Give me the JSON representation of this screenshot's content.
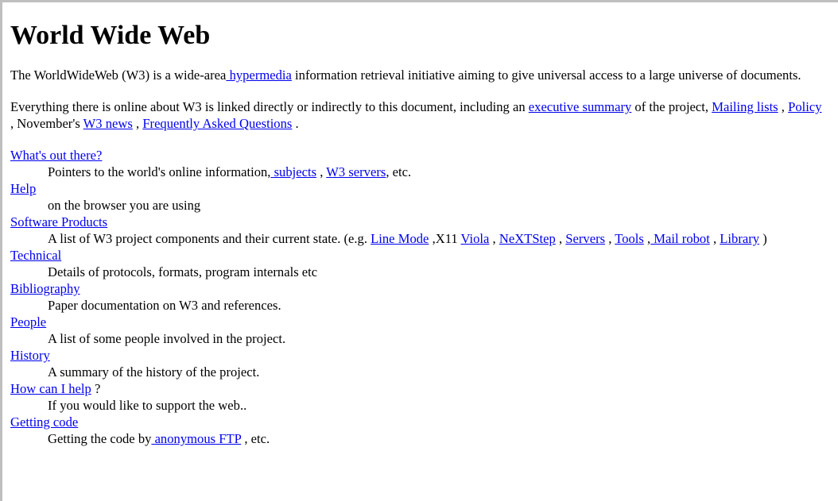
{
  "page": {
    "title": "World Wide Web",
    "intro": {
      "before": "The WorldWideWeb (W3) is a wide-area",
      "link": " hypermedia",
      "after": " information retrieval initiative aiming to give universal access to a large universe of documents."
    },
    "summary": {
      "t1": "Everything there is online about W3 is linked directly or indirectly to this document, including an ",
      "link_exec": "executive summary",
      "t2": " of the project, ",
      "link_mailing": "Mailing lists",
      "t3": " , ",
      "link_policy": "Policy",
      "t4": " , November's ",
      "link_news": "W3 news",
      "t5": " , ",
      "link_faq": "Frequently Asked Questions",
      "t6": " ."
    },
    "items": {
      "whats_out": {
        "term": "What's out there?",
        "d1": "Pointers to the world's online information,",
        "link_subjects": " subjects",
        "d2": " , ",
        "link_servers": "W3 servers",
        "d3": ", etc."
      },
      "help": {
        "term": "Help",
        "desc": "on the browser you are using"
      },
      "software": {
        "term": "Software Products",
        "d1": "A list of W3 project components and their current state. (e.g. ",
        "link_linemode": "Line Mode",
        "d2": " ,X11 ",
        "link_viola": "Viola",
        "d3": " , ",
        "link_next": "NeXTStep",
        "d4": " , ",
        "link_servers": "Servers",
        "d5": " , ",
        "link_tools": "Tools",
        "d6": " ,",
        "link_mailrobot": " Mail robot",
        "d7": " , ",
        "link_library": "Library",
        "d8": " )"
      },
      "technical": {
        "term": "Technical",
        "desc": "Details of protocols, formats, program internals etc"
      },
      "bibliography": {
        "term": "Bibliography",
        "desc": "Paper documentation on W3 and references."
      },
      "people": {
        "term": "People",
        "desc": "A list of some people involved in the project."
      },
      "history": {
        "term": "History",
        "desc": "A summary of the history of the project."
      },
      "howhelp": {
        "term": "How can I help",
        "suffix": " ?",
        "desc": "If you would like to support the web.."
      },
      "gettingcode": {
        "term": "Getting code",
        "d1": "Getting the code by",
        "link_ftp": " anonymous FTP",
        "d2": " , etc."
      }
    }
  }
}
